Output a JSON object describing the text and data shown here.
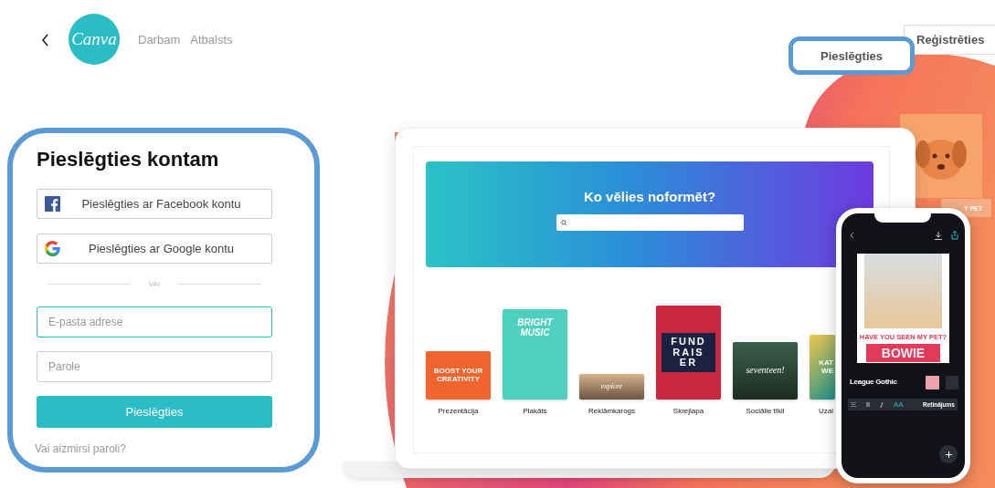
{
  "header": {
    "logo": "Canva",
    "nav": [
      {
        "label": "Darbam"
      },
      {
        "label": "Atbalsts"
      }
    ],
    "actions": [
      {
        "label": "Pieslēgties",
        "kind": "plain",
        "highlighted": true
      },
      {
        "label": "Reģistrēties",
        "kind": "outlined",
        "highlighted": false
      }
    ]
  },
  "login": {
    "title": "Pieslēgties kontam",
    "highlighted": true,
    "social": [
      {
        "label": "Pieslēgties ar Facebook kontu",
        "kind": "facebook"
      },
      {
        "label": "Pieslēgties ar Google kontu",
        "kind": "google"
      }
    ],
    "divider": "VAI",
    "fields": [
      {
        "placeholder": "E-pasta adrese",
        "focused": true
      },
      {
        "placeholder": "Parole",
        "focused": false
      }
    ],
    "submit": "Pieslēgties",
    "forgot_link": "Vai aizmirsi paroli?"
  },
  "hero": {
    "card_text": "Y PET",
    "banner_title": "Ko vēlies noformēt?",
    "templates": [
      {
        "label": "Prezentācija",
        "kind": "presentation",
        "thumb_lines": [
          "BOOST YOUR",
          "CREATIVITY"
        ]
      },
      {
        "label": "Plakāts",
        "kind": "poster",
        "thumb_lines": [
          "BRIGHT",
          "MUSIC"
        ]
      },
      {
        "label": "Reklāmkarogs",
        "kind": "banner",
        "thumb_lines": [
          "explore"
        ]
      },
      {
        "label": "Skrejlapa",
        "kind": "flyer",
        "thumb_lines": [
          "FUND",
          "RAIS",
          "ER"
        ]
      },
      {
        "label": "Sociālie tīkli",
        "kind": "social",
        "thumb_lines": [
          "seventeen!"
        ]
      },
      {
        "label": "Uzai",
        "kind": "cut",
        "thumb_lines": [
          "KAT",
          "WE"
        ]
      }
    ],
    "phone": {
      "poster_caption": "HAVE YOU SEEN MY PET?",
      "poster_name": "BOWIE",
      "font_name": "League Gothic",
      "size_toggle": "AA",
      "toolbar_label": "Retinājums"
    }
  }
}
